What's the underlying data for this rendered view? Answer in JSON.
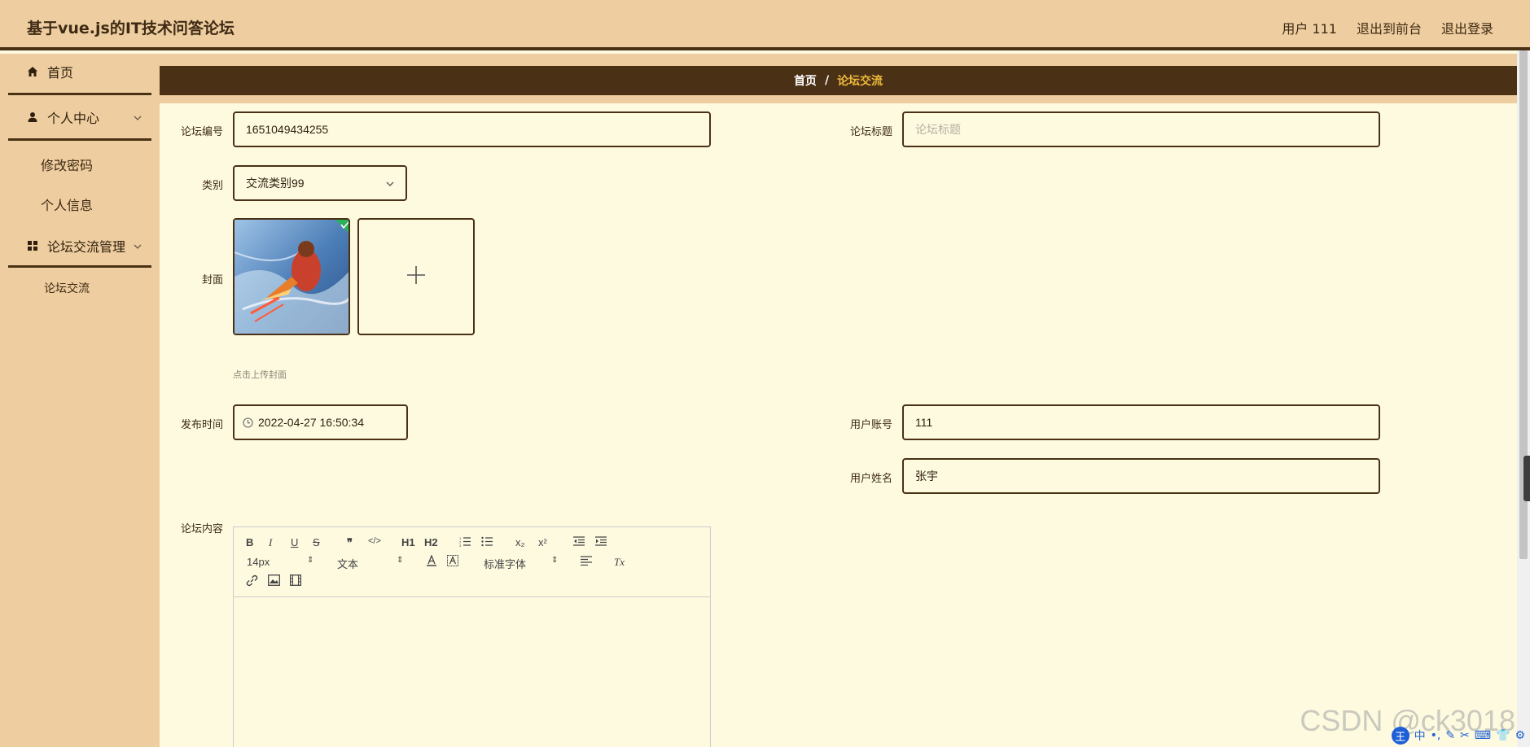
{
  "app": {
    "title": "基于vue.js的IT技术问答论坛"
  },
  "header": {
    "user_label": "用户 111",
    "to_front_label": "退出到前台",
    "logout_label": "退出登录"
  },
  "sidebar": {
    "home": "首页",
    "personal_center": "个人中心",
    "change_password": "修改密码",
    "personal_info": "个人信息",
    "forum_management": "论坛交流管理",
    "forum_exchange": "论坛交流"
  },
  "breadcrumb": {
    "home": "首页",
    "separator": "/",
    "current": "论坛交流"
  },
  "form": {
    "forum_no_label": "论坛编号",
    "forum_no_value": "1651049434255",
    "title_label": "论坛标题",
    "title_placeholder": "论坛标题",
    "category_label": "类别",
    "category_value": "交流类别99",
    "cover_label": "封面",
    "cover_tip": "点击上传封面",
    "publish_time_label": "发布时间",
    "publish_time_value": "2022-04-27 16:50:34",
    "account_label": "用户账号",
    "account_value": "111",
    "name_label": "用户姓名",
    "name_value": "张宇",
    "content_label": "论坛内容"
  },
  "editor": {
    "bold": "B",
    "italic": "I",
    "underline": "U",
    "strike": "S",
    "quote": "❞",
    "code": "</>",
    "h1": "H1",
    "h2": "H2",
    "sub": "x₂",
    "sup": "x²",
    "font_size": "14px",
    "paragraph": "文本",
    "font_family": "标准字体",
    "clean": "Tx"
  },
  "watermark": "CSDN @ck3018",
  "ime": {
    "logo": "王",
    "mode": "中"
  },
  "colors": {
    "header_bg": "#eecea0",
    "dark_brown": "#4a3116",
    "content_bg": "#fdfae0",
    "accent": "#f0b93a"
  }
}
